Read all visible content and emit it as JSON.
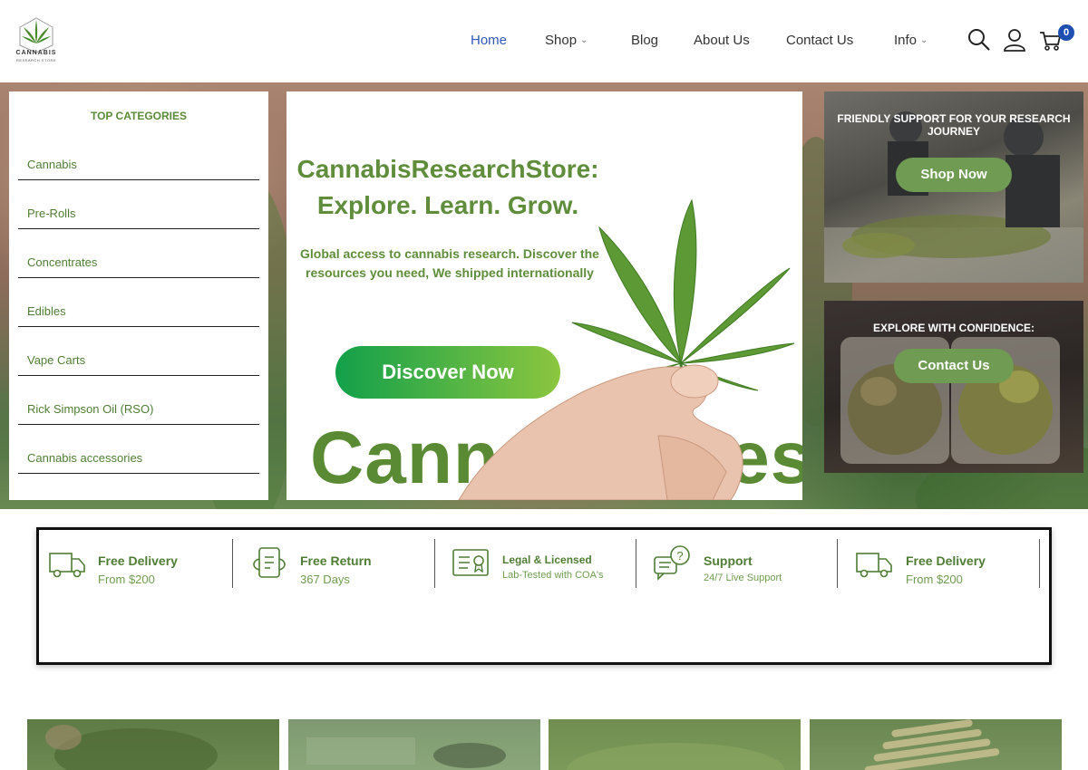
{
  "logo": {
    "text": "CANNABIS",
    "sub": "RESEARCH STORE"
  },
  "nav": {
    "home": "Home",
    "shop": "Shop",
    "blog": "Blog",
    "about": "About Us",
    "contact": "Contact Us",
    "info": "Info"
  },
  "header_icons": [
    "search-icon",
    "user-icon",
    "cart-icon"
  ],
  "cart": {
    "count": "0"
  },
  "categories": {
    "title": "TOP CATEGORIES",
    "items": [
      "Cannabis",
      "Pre-Rolls",
      "Concentrates",
      "Edibles",
      "Vape Carts",
      "Rick Simpson Oil (RSO)",
      "Cannabis accessories"
    ]
  },
  "banner": {
    "heading_line1": "CannabisResearchStore:",
    "heading_line2": "Explore. Learn. Grow.",
    "body": "Global access to cannabis research. Discover the resources you need, We shipped internationally",
    "button": "Discover Now",
    "big_text": "Cannabis Res"
  },
  "promos": [
    {
      "title": "FRIENDLY SUPPORT FOR YOUR RESEARCH JOURNEY",
      "button": "Shop Now"
    },
    {
      "title": "EXPLORE WITH CONFIDENCE:",
      "button": "Contact Us"
    }
  ],
  "features": [
    {
      "title": "Free Delivery",
      "sub": "From $200",
      "icon": "truck-icon"
    },
    {
      "title": "Free Return",
      "sub": "367 Days",
      "icon": "return-icon"
    },
    {
      "title": "Legal & Licensed",
      "sub": "Lab-Tested with COA's",
      "icon": "certificate-icon"
    },
    {
      "title": "Support",
      "sub": "24/7 Live Support",
      "icon": "support-chat-icon"
    },
    {
      "title": "Free Delivery",
      "sub": "From $200",
      "icon": "truck-icon"
    }
  ],
  "colors": {
    "brand_green": "#5f8d3b",
    "nav_active": "#2e57b8",
    "badge": "#1f4fb0",
    "button_green": "#6f9b52"
  }
}
